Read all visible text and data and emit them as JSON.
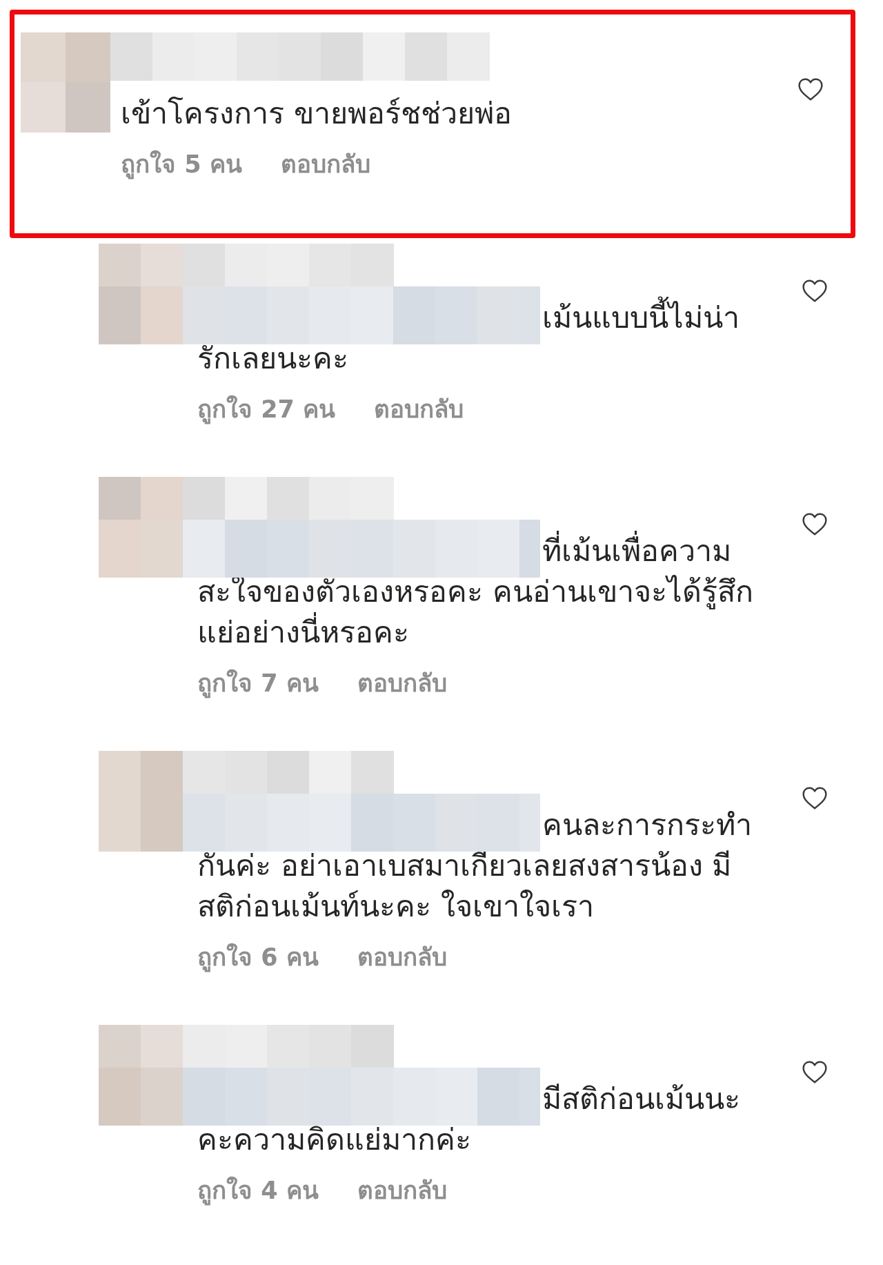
{
  "comments": [
    {
      "kind": "comment",
      "highlighted": true,
      "text": "เข้าโครงการ ขายพอร์ชช่วยพ่อ",
      "likes": "ถูกใจ 5 คน",
      "reply": "ตอบกลับ"
    },
    {
      "kind": "reply",
      "highlighted": false,
      "text": "เม้นแบบนี้ไม่น่ารักเลยนะคะ",
      "likes": "ถูกใจ 27 คน",
      "reply": "ตอบกลับ"
    },
    {
      "kind": "reply",
      "highlighted": false,
      "text": "ที่เม้นเพื่อความสะใจของตัวเองหรอคะ คนอ่านเขาจะได้รู้สึกแย่อย่างนี่หรอคะ",
      "likes": "ถูกใจ 7 คน",
      "reply": "ตอบกลับ"
    },
    {
      "kind": "reply",
      "highlighted": false,
      "text": "คนละการกระทำกันค่ะ อย่าเอาเบสมาเกียวเลยสงสารน้อง มีสติก่อนเม้นท์นะคะ ใจเขาใจเรา",
      "likes": "ถูกใจ 6 คน",
      "reply": "ตอบกลับ"
    },
    {
      "kind": "reply",
      "highlighted": false,
      "text": "มีสติก่อนเม้นนะคะความคิดแย่มากค่ะ",
      "likes": "ถูกใจ 4 คน",
      "reply": "ตอบกลับ"
    }
  ]
}
